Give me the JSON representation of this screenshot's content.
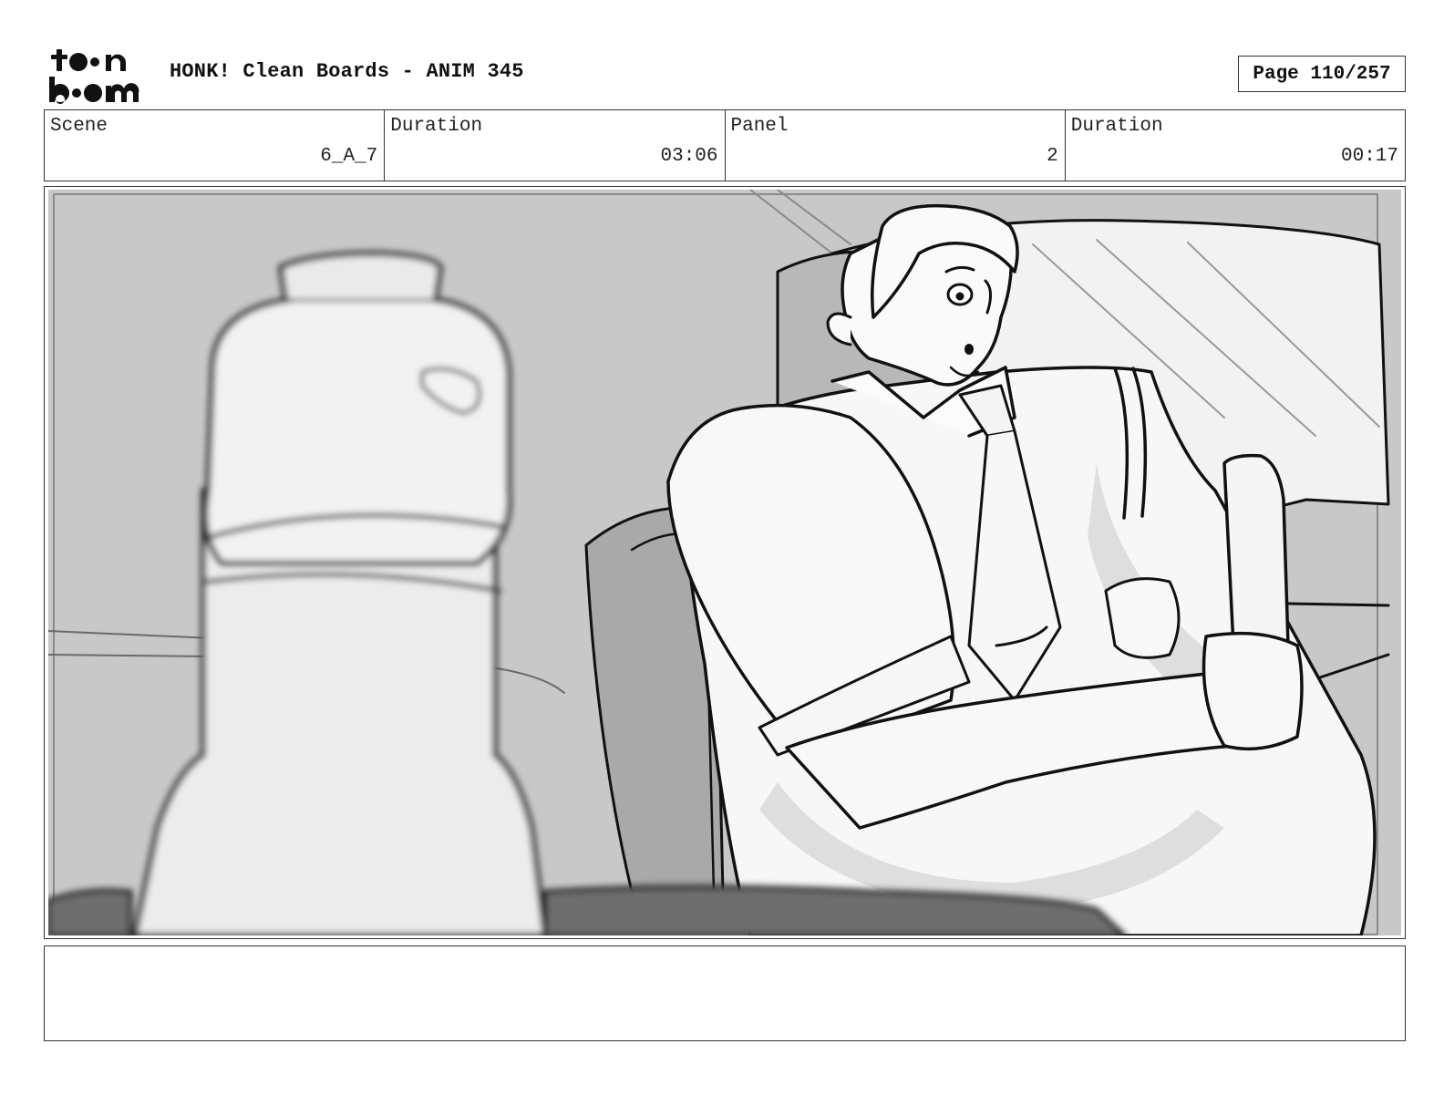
{
  "header": {
    "logo_text": "toon boom",
    "title": "HONK! Clean Boards - ANIM 345",
    "page": "Page 110/257"
  },
  "info": [
    {
      "label": "Scene",
      "value": "6_A_7"
    },
    {
      "label": "Duration",
      "value": "03:06"
    },
    {
      "label": "Panel",
      "value": "2"
    },
    {
      "label": "Duration",
      "value": "00:17"
    }
  ],
  "panel": {
    "image": "storyboard-sketch",
    "palette": {
      "bg": "#c8c8c8",
      "light": "#f4f4f4",
      "mid": "#a9a9a9",
      "dark": "#6e6e6e",
      "line": "#111111"
    }
  },
  "caption": {
    "text": ""
  }
}
